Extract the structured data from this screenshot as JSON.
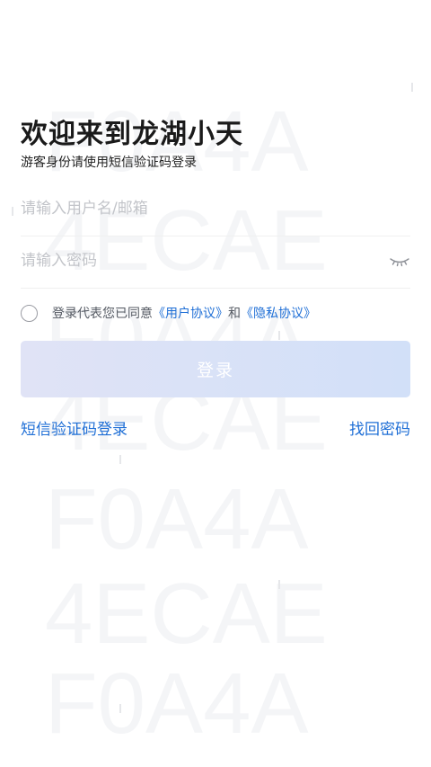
{
  "header": {
    "title": "欢迎来到龙湖小天",
    "subtitle": "游客身份请使用短信验证码登录"
  },
  "form": {
    "username_placeholder": "请输入用户名/邮箱",
    "username_value": "",
    "password_placeholder": "请输入密码",
    "password_value": "",
    "password_toggle_icon": "eye-closed-icon"
  },
  "agreement": {
    "prefix": "登录代表您已同意",
    "user_agreement": "《用户协议》",
    "conjunction": "和",
    "privacy_policy": "《隐私协议》",
    "checked": false
  },
  "actions": {
    "login_label": "登录",
    "sms_login_label": "短信验证码登录",
    "forgot_password_label": "找回密码"
  },
  "watermark": {
    "lines": [
      "F0A4A",
      "4ECAE",
      "F0A4A",
      "4ECAE",
      "F0A4A",
      "4ECAE",
      "F0A4A"
    ]
  },
  "colors": {
    "link": "#1f6fd6",
    "button_gradient_start": "#e0e3f6",
    "button_gradient_end": "#d2e0f8",
    "placeholder": "#c2c4c9",
    "title": "#1a1a1a"
  }
}
